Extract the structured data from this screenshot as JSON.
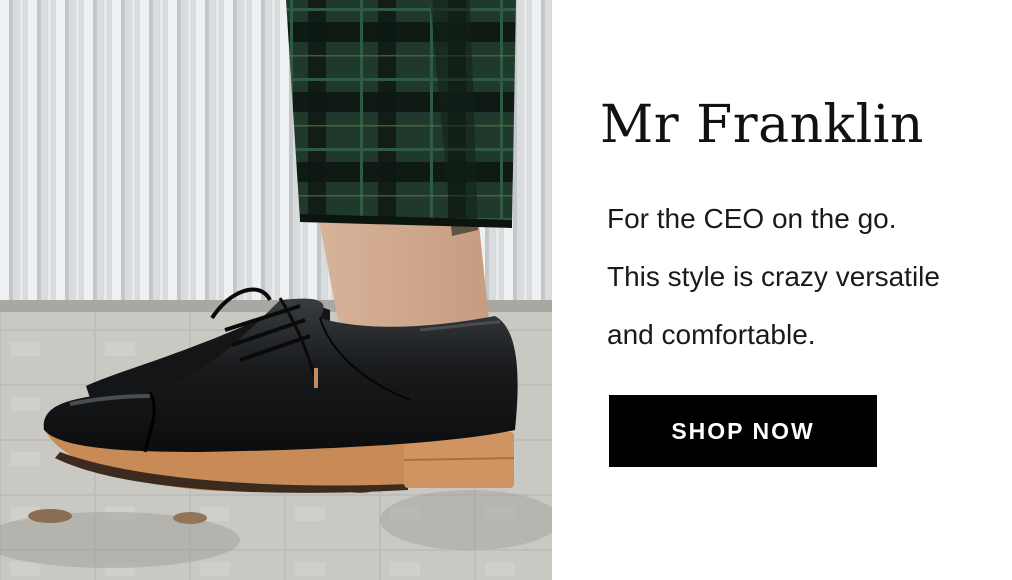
{
  "product": {
    "name": "Mr Franklin",
    "description_lines": [
      "For the CEO on the go.",
      "This style is crazy versatile",
      "and comfortable."
    ]
  },
  "cta": {
    "label": "SHOP NOW"
  },
  "image": {
    "subject": "black leather cap-toe oxford shoe worn with green plaid trousers"
  },
  "colors": {
    "button_bg": "#000000",
    "button_text": "#ffffff",
    "title_text": "#111111",
    "background": "#ffffff"
  }
}
